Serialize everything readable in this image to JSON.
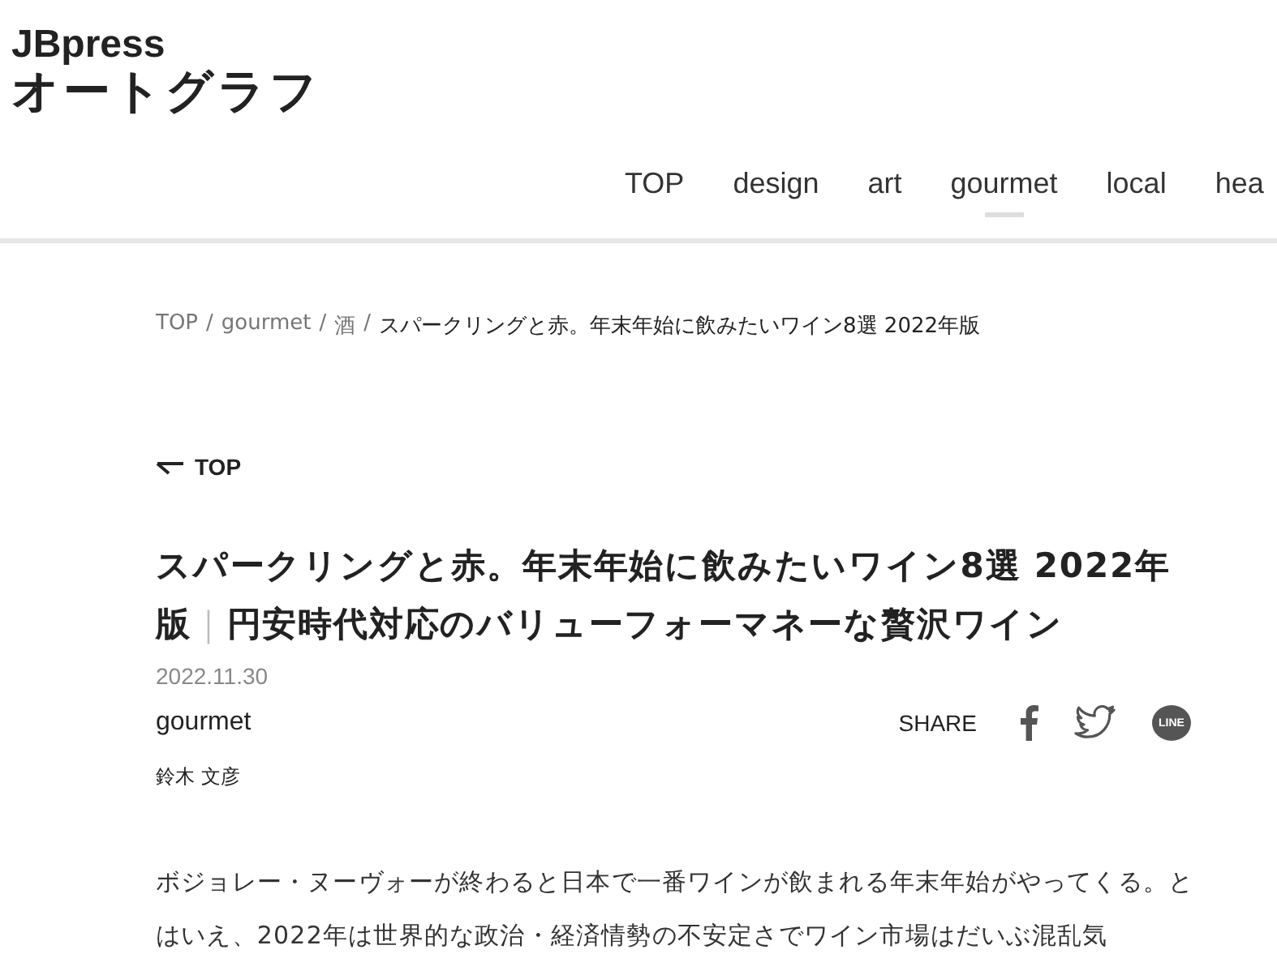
{
  "logo": {
    "line_1": "JBpress",
    "line_2": "オートグラフ"
  },
  "nav": [
    {
      "label": "TOP",
      "selected": false
    },
    {
      "label": "design",
      "selected": false
    },
    {
      "label": "art",
      "selected": false
    },
    {
      "label": "gourmet",
      "selected": true
    },
    {
      "label": "local",
      "selected": false
    },
    {
      "label": "hea",
      "selected": false
    }
  ],
  "breadcrumb": [
    {
      "label": "TOP",
      "kind": "link"
    },
    {
      "separator": "/",
      "label": "gourmet",
      "kind": "link"
    },
    {
      "separator": "/",
      "label": "酒",
      "kind": "link"
    },
    {
      "separator": "/",
      "label": "スパークリングと赤。年末年始に飲みたいワイン8選 2022年版",
      "kind": "current"
    }
  ],
  "back_link": "TOP",
  "article": {
    "title_start": "スパークリングと赤。年末年始に飲みたいワイン8選 2022年版",
    "title_separator": "｜",
    "title_end": "円安時代対応のバリューフォーマネーな贅沢ワイン",
    "date": "2022.11.30",
    "category": "gourmet",
    "share_label": "SHARE",
    "share": [
      {
        "kind": "facebook"
      },
      {
        "kind": "twitter"
      },
      {
        "kind": "line",
        "label": "LINE"
      }
    ],
    "author": "鈴木 文彦",
    "body": "ボジョレー・ヌーヴォーが終わると日本で一番ワインが飲まれる年末年始がやってくる。とはいえ、2022年は世界的な政治・経済情勢の不安定さでワイン市場はだいぶ混乱気"
  }
}
